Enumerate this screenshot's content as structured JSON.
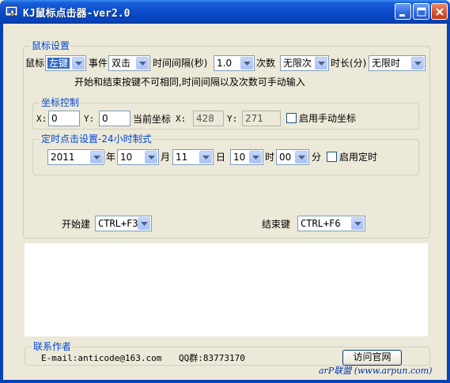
{
  "title": "KJ鼠标点击器-ver2.0",
  "mouse_settings": {
    "title": "鼠标设置",
    "mouse_label": "鼠标",
    "mouse_value": "左键",
    "event_label": "事件",
    "event_value": "双击",
    "interval_label": "时间间隔(秒)",
    "interval_value": "1.0",
    "count_label": "次数",
    "count_value": "无限次",
    "duration_label": "时长(分)",
    "duration_value": "无限时",
    "hint": "开始和结束按键不可相同,时间间隔以及次数可手动输入"
  },
  "coord": {
    "title": "坐标控制",
    "x_label": "X:",
    "x_value": "0",
    "y_label": "Y:",
    "y_value": "0",
    "current_label": "当前坐标",
    "cur_x_label": "X:",
    "cur_x_value": "428",
    "cur_y_label": "Y:",
    "cur_y_value": "271",
    "manual_label": "启用手动坐标",
    "manual_checked": false
  },
  "timer": {
    "title": "定时点击设置-24小时制式",
    "year": "2011",
    "year_label": "年",
    "month": "10",
    "month_label": "月",
    "day": "11",
    "day_label": "日",
    "hour": "10",
    "hour_label": "时",
    "minute": "00",
    "minute_label": "分",
    "enable_label": "启用定时",
    "enable_checked": false
  },
  "hotkeys": {
    "start_label": "开始建",
    "start_value": "CTRL+F3",
    "end_label": "结束键",
    "end_value": "CTRL+F6"
  },
  "contact": {
    "title": "联系作者",
    "email": "E-mail:anticode@163.com",
    "qq": "QQ群:83773170",
    "visit_button": "访问官网"
  },
  "watermark": "arP联盟 (www.arpun.com)",
  "colors": {
    "titlebar": "#0a4ccc",
    "group_title": "#0046d5",
    "selection": "#316ac5",
    "background": "#ece9d8"
  }
}
